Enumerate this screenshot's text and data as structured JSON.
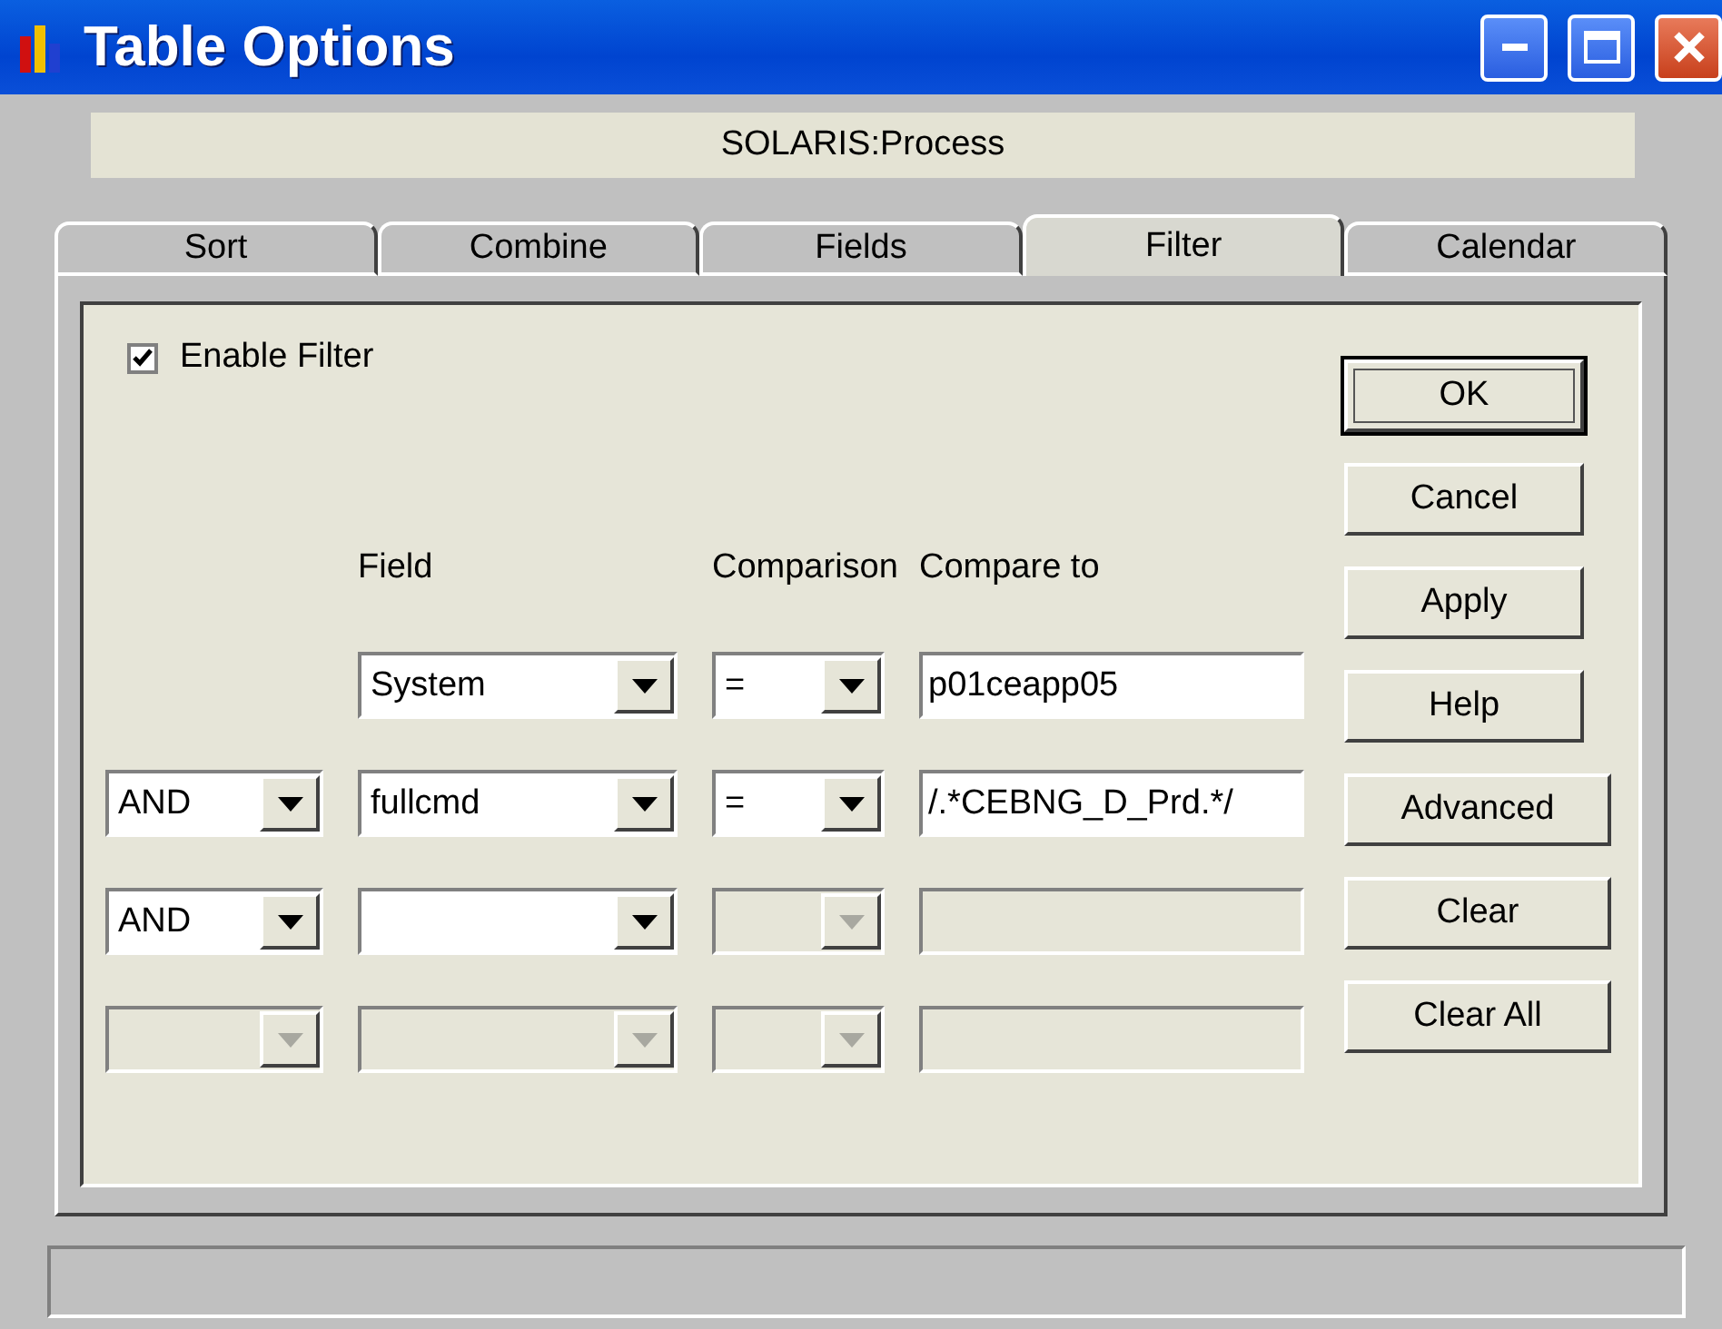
{
  "window": {
    "title": "Table Options"
  },
  "subtitle": "SOLARIS:Process",
  "tabs": [
    {
      "label": "Sort",
      "selected": false
    },
    {
      "label": "Combine",
      "selected": false
    },
    {
      "label": "Fields",
      "selected": false
    },
    {
      "label": "Filter",
      "selected": true
    },
    {
      "label": "Calendar",
      "selected": false
    }
  ],
  "enable_filter": {
    "label": "Enable Filter",
    "checked": true
  },
  "headers": {
    "field": "Field",
    "comparison": "Comparison",
    "compare_to": "Compare to"
  },
  "rows": [
    {
      "field": {
        "value": "System",
        "disabled": false
      },
      "comparison": {
        "value": "=",
        "disabled": false
      },
      "compare_to": {
        "value": "p01ceapp05",
        "disabled": false
      }
    },
    {
      "connector": {
        "value": "AND",
        "disabled": false
      },
      "field": {
        "value": "fullcmd",
        "disabled": false
      },
      "comparison": {
        "value": "=",
        "disabled": false
      },
      "compare_to": {
        "value": "/.*CEBNG_D_Prd.*/",
        "disabled": false
      }
    },
    {
      "connector": {
        "value": "AND",
        "disabled": false
      },
      "field": {
        "disabled": false
      },
      "comparison": {
        "disabled": true
      },
      "compare_to": {
        "disabled": true
      }
    },
    {
      "connector": {
        "disabled": true
      },
      "field": {
        "disabled": true
      },
      "comparison": {
        "disabled": true
      },
      "compare_to": {
        "disabled": true
      }
    }
  ],
  "buttons": [
    {
      "label": "OK",
      "focused": true
    },
    {
      "label": "Cancel",
      "focused": false
    },
    {
      "label": "Apply",
      "focused": false
    },
    {
      "label": "Help",
      "focused": false
    }
  ],
  "filter_buttons": [
    {
      "label": "Advanced"
    },
    {
      "label": "Clear"
    },
    {
      "label": "Clear All"
    }
  ]
}
